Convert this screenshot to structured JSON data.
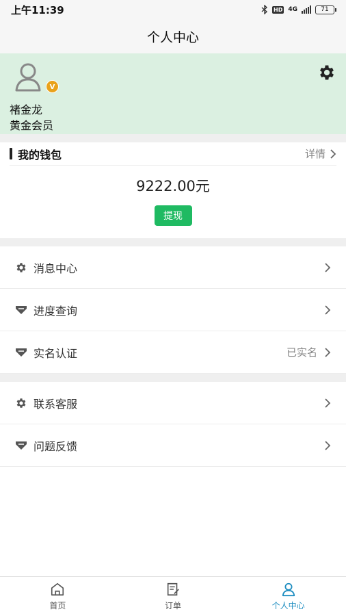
{
  "status_bar": {
    "time": "上午11:39",
    "hd": "HD",
    "network": "4G",
    "battery": "71"
  },
  "header": {
    "title": "个人中心"
  },
  "profile": {
    "name": "褚金龙",
    "level": "黄金会员",
    "badge": "V"
  },
  "wallet": {
    "title": "我的钱包",
    "detail_label": "详情",
    "balance": "9222.00元",
    "withdraw_label": "提现"
  },
  "menu_group_1": [
    {
      "label": "消息中心",
      "icon": "gear-icon",
      "value": ""
    },
    {
      "label": "进度查询",
      "icon": "diamond-icon",
      "value": ""
    },
    {
      "label": "实名认证",
      "icon": "diamond-icon",
      "value": "已实名"
    }
  ],
  "menu_group_2": [
    {
      "label": "联系客服",
      "icon": "gear-icon",
      "value": ""
    },
    {
      "label": "问题反馈",
      "icon": "diamond-icon",
      "value": ""
    }
  ],
  "tabs": [
    {
      "label": "首页",
      "icon": "home-icon",
      "active": false
    },
    {
      "label": "订单",
      "icon": "order-icon",
      "active": false
    },
    {
      "label": "个人中心",
      "icon": "person-icon",
      "active": true
    }
  ],
  "colors": {
    "accent": "#1f8ec1",
    "profile_bg": "#dbf0e1",
    "withdraw_btn": "#1fba62",
    "vip_badge": "#e9a21b"
  }
}
